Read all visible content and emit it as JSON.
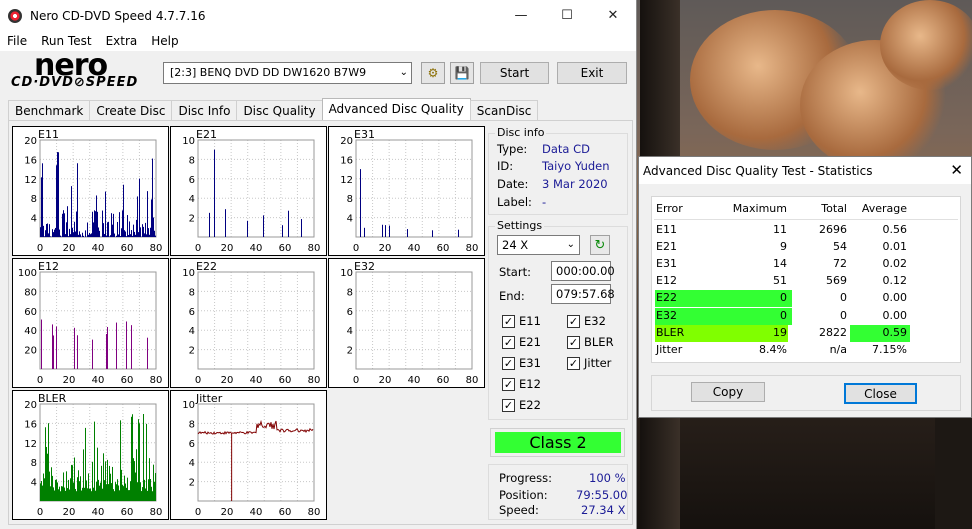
{
  "window": {
    "title": "Nero CD-DVD Speed 4.7.7.16"
  },
  "menu": [
    "File",
    "Run Test",
    "Extra",
    "Help"
  ],
  "brand": {
    "nero": "nero",
    "sub": "CD·DVD⊘SPEED"
  },
  "drive": {
    "selected": "[2:3]   BENQ DVD DD DW1620 B7W9"
  },
  "buttons": {
    "start": "Start",
    "exit": "Exit"
  },
  "tabs": [
    "Benchmark",
    "Create Disc",
    "Disc Info",
    "Disc Quality",
    "Advanced Disc Quality",
    "ScanDisc"
  ],
  "disc_info": {
    "heading": "Disc info",
    "type_label": "Type:",
    "type": "Data CD",
    "id_label": "ID:",
    "id": "Taiyo Yuden",
    "date_label": "Date:",
    "date": "3 Mar 2020",
    "label_label": "Label:",
    "label": "-"
  },
  "settings": {
    "heading": "Settings",
    "speed": "24 X",
    "start_label": "Start:",
    "start": "000:00.00",
    "end_label": "End:",
    "end": "079:57.68",
    "checks": [
      {
        "label": "E11",
        "checked": true
      },
      {
        "label": "E32",
        "checked": true
      },
      {
        "label": "E21",
        "checked": true
      },
      {
        "label": "BLER",
        "checked": true
      },
      {
        "label": "E31",
        "checked": true
      },
      {
        "label": "Jitter",
        "checked": true
      },
      {
        "label": "E12",
        "checked": true
      },
      {
        "label": "E22",
        "checked": true
      }
    ]
  },
  "class_badge": "Class 2",
  "progress": {
    "progress_label": "Progress:",
    "progress": "100 %",
    "position_label": "Position:",
    "position": "79:55.00",
    "speed_label": "Speed:",
    "speed": "27.34 X"
  },
  "colors": {
    "accent_green": "#33ff33",
    "bler_green": "#80ff00",
    "navy": "#000080",
    "purple": "#800080",
    "dkgreen": "#008000",
    "maroon": "#800000"
  },
  "chart_data": [
    {
      "type": "bar",
      "title": "E11",
      "x_ticks": [
        "0",
        "20",
        "40",
        "60",
        "80"
      ],
      "y_ticks": [
        "20",
        "16",
        "12",
        "8",
        "4"
      ],
      "ylim": [
        0,
        20
      ],
      "color": "navy"
    },
    {
      "type": "bar",
      "title": "E21",
      "x_ticks": [
        "0",
        "20",
        "40",
        "60",
        "80"
      ],
      "y_ticks": [
        "10",
        "8",
        "6",
        "4",
        "2"
      ],
      "ylim": [
        0,
        10
      ],
      "color": "navy"
    },
    {
      "type": "bar",
      "title": "E31",
      "x_ticks": [
        "0",
        "20",
        "40",
        "60",
        "80"
      ],
      "y_ticks": [
        "20",
        "16",
        "12",
        "8",
        "4"
      ],
      "ylim": [
        0,
        20
      ],
      "color": "navy"
    },
    {
      "type": "bar",
      "title": "E12",
      "x_ticks": [
        "0",
        "20",
        "40",
        "60",
        "80"
      ],
      "y_ticks": [
        "100",
        "80",
        "60",
        "40",
        "20"
      ],
      "ylim": [
        0,
        100
      ],
      "color": "purple"
    },
    {
      "type": "bar",
      "title": "E22",
      "x_ticks": [
        "0",
        "20",
        "40",
        "60",
        "80"
      ],
      "y_ticks": [
        "10",
        "8",
        "6",
        "4",
        "2"
      ],
      "ylim": [
        0,
        10
      ],
      "color": "purple"
    },
    {
      "type": "bar",
      "title": "E32",
      "x_ticks": [
        "0",
        "20",
        "40",
        "60",
        "80"
      ],
      "y_ticks": [
        "10",
        "8",
        "6",
        "4",
        "2"
      ],
      "ylim": [
        0,
        10
      ],
      "color": "purple"
    },
    {
      "type": "bar",
      "title": "BLER",
      "x_ticks": [
        "0",
        "20",
        "40",
        "60",
        "80"
      ],
      "y_ticks": [
        "20",
        "16",
        "12",
        "8",
        "4"
      ],
      "ylim": [
        0,
        20
      ],
      "color": "dkgreen"
    },
    {
      "type": "line",
      "title": "Jitter",
      "x_ticks": [
        "0",
        "20",
        "40",
        "60",
        "80"
      ],
      "y_ticks": [
        "10",
        "8",
        "6",
        "4",
        "2"
      ],
      "ylim": [
        0,
        10
      ],
      "color": "maroon"
    }
  ],
  "stats": {
    "title": "Advanced Disc Quality Test - Statistics",
    "headers": [
      "Error",
      "Maximum",
      "Total",
      "Average"
    ],
    "rows": [
      [
        "E11",
        "11",
        "2696",
        "0.56"
      ],
      [
        "E21",
        "9",
        "54",
        "0.01"
      ],
      [
        "E31",
        "14",
        "72",
        "0.02"
      ],
      [
        "E12",
        "51",
        "569",
        "0.12"
      ],
      [
        "E22",
        "0",
        "0",
        "0.00"
      ],
      [
        "E32",
        "0",
        "0",
        "0.00"
      ],
      [
        "BLER",
        "19",
        "2822",
        "0.59"
      ],
      [
        "Jitter",
        "8.4%",
        "n/a",
        "7.15%"
      ]
    ],
    "copy": "Copy",
    "close": "Close"
  }
}
